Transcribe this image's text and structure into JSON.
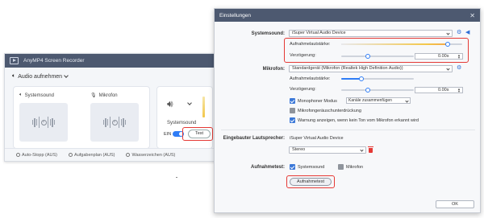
{
  "recorder": {
    "title": "AnyMP4 Screen Recorder",
    "mode": "Audio aufnehmen",
    "system_sound": "Systemsound",
    "microphone": "Mikrofon",
    "panel_system_label": "Systemsound",
    "toggle_label": "EIN",
    "test_button": "Test",
    "footer": {
      "auto_stop": "Auto-Stopp (AUS)",
      "schedule": "Aufgabenplan (AUS)",
      "watermark": "Wasserzeichen (AUS)"
    }
  },
  "settings": {
    "title": "Einstellungen",
    "systemsound": {
      "label": "Systemsound:",
      "device": "iSuper Virtual Audio Device",
      "volume_label": "Aufnahmelautstärke:",
      "volume_level": 0.88,
      "delay_label": "Verzögerung:",
      "delay_value": "0.00s"
    },
    "microphone": {
      "label": "Mikrofon:",
      "device": "Standardgerät (Mikrofon (Realtek High Definition Audio))",
      "volume_label": "Aufnahmelautstärke:",
      "volume_level": 0.28,
      "delay_label": "Verzögerung:",
      "delay_value": "0.00s",
      "mono_label": "Monophoner Modus",
      "mono_option": "Kanäle zusammenfügen",
      "noise_label": "Mikrofongeräuschunterdrückung",
      "warn_label": "Warnung anzeigen, wenn kein Ton vom Mikrofon erkannt wird"
    },
    "speaker": {
      "label": "Eingebauter Lautsprecher:",
      "device": "iSuper Virtual Audio Device",
      "channel": "Stereo"
    },
    "record_test": {
      "label": "Aufnahmetest:",
      "system_label": "Systemsound",
      "mic_label": "Mikrofon",
      "button": "Aufnahmetest"
    },
    "ok_button": "OK"
  },
  "colors": {
    "titlebar": "#4d5970",
    "accent": "#2f7df6",
    "highlight": "#e53935"
  }
}
